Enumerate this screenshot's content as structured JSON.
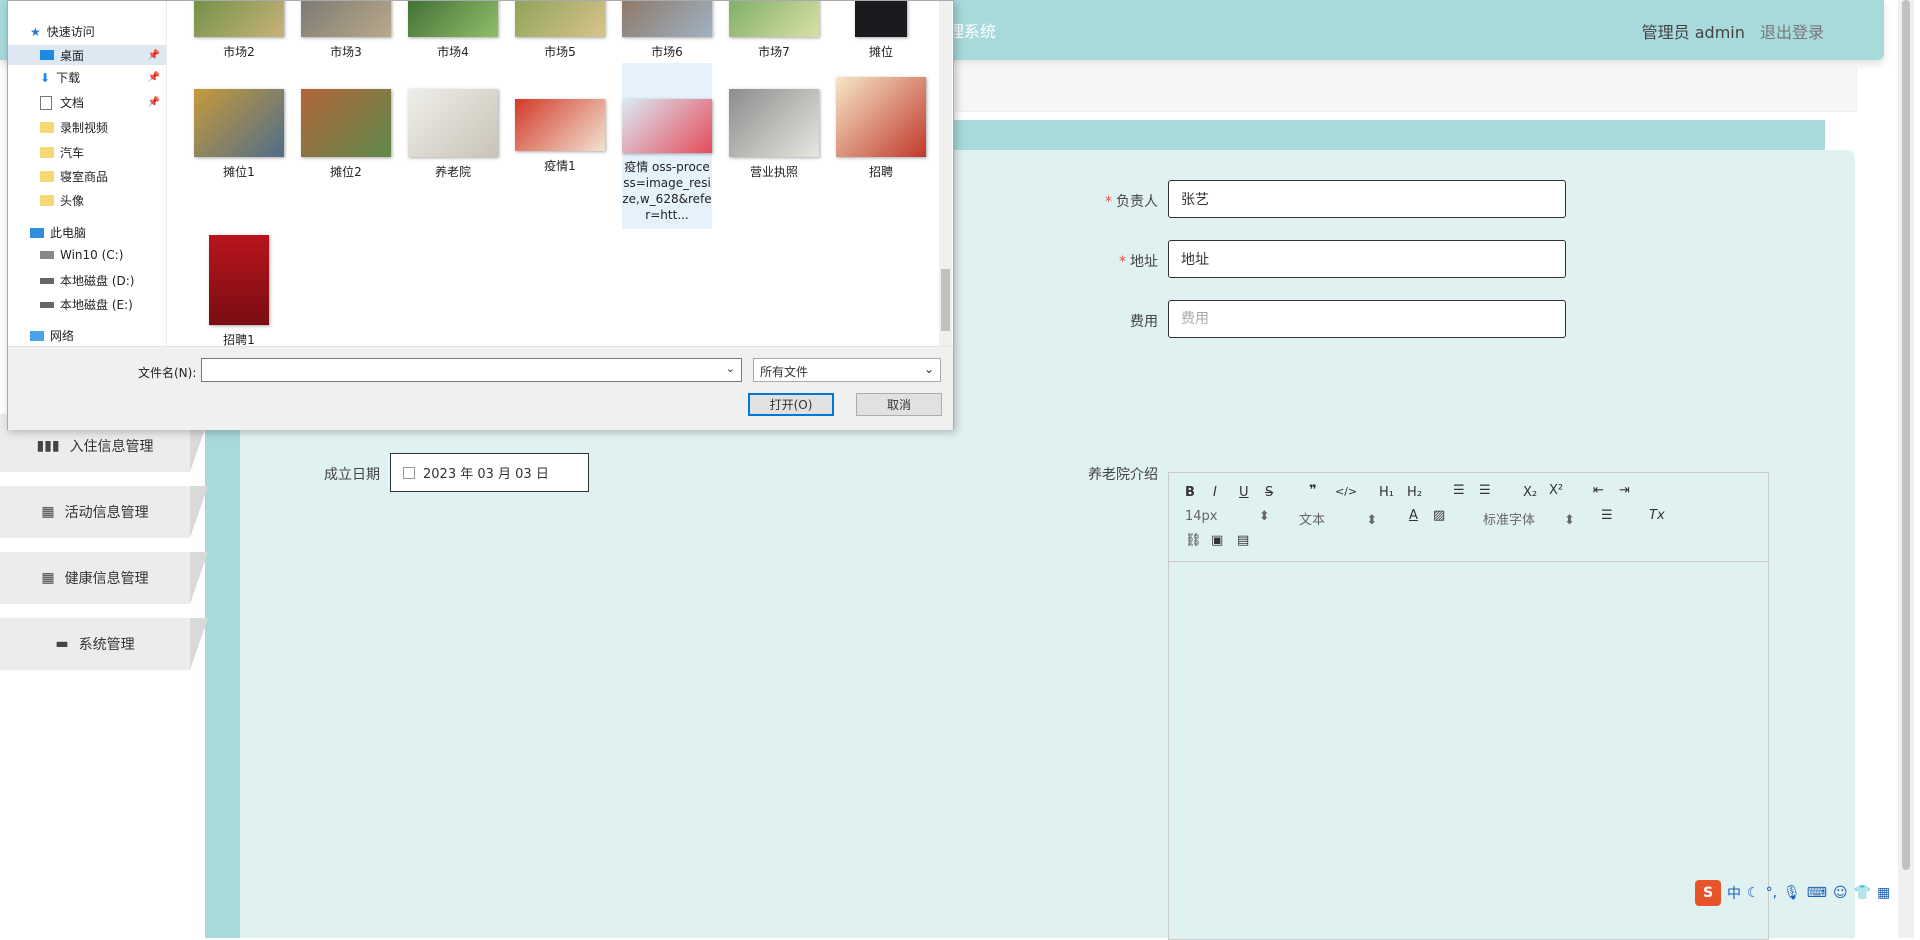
{
  "app": {
    "title_partial": "理系统",
    "admin_label": "管理员 admin",
    "logout": "退出登录"
  },
  "sidebar": {
    "items": [
      {
        "label": "入住信息管理",
        "icon": "bar-chart-icon"
      },
      {
        "label": "活动信息管理",
        "icon": "grid-icon"
      },
      {
        "label": "健康信息管理",
        "icon": "grid-icon"
      },
      {
        "label": "系统管理",
        "icon": "chat-icon"
      }
    ]
  },
  "form": {
    "manager_label": "负责人",
    "manager_value": "张艺",
    "address_label": "地址",
    "address_value": "地址",
    "fee_label": "费用",
    "fee_placeholder": "费用",
    "date_label": "成立日期",
    "date_value": "2023 年 03 月 03 日",
    "intro_label": "养老院介绍"
  },
  "editor": {
    "font_size": "14px",
    "text_type": "文本",
    "font_family": "标准字体"
  },
  "dialog": {
    "nav": {
      "quick_access": "快速访问",
      "desktop": "桌面",
      "downloads": "下载",
      "documents": "文档",
      "recorded_videos": "录制视频",
      "car": "汽车",
      "bedroom_goods": "寝室商品",
      "avatar": "头像",
      "this_pc": "此电脑",
      "drive_c": "Win10 (C:)",
      "drive_d": "本地磁盘 (D:)",
      "drive_e": "本地磁盘 (E:)",
      "network": "网络"
    },
    "files_row1": [
      "市场2",
      "市场3",
      "市场4",
      "市场5",
      "市场6",
      "市场7",
      "摊位"
    ],
    "files_row2": [
      "摊位1",
      "摊位2",
      "养老院",
      "疫情1",
      "疫情 oss-process=image_resize,w_628&refer=htt...",
      "营业执照",
      "招聘"
    ],
    "files_row3": [
      "招聘1"
    ],
    "filename_label": "文件名(N):",
    "filetype": "所有文件",
    "open_button": "打开(O)",
    "cancel_button": "取消"
  },
  "ime": {
    "mode": "中"
  }
}
